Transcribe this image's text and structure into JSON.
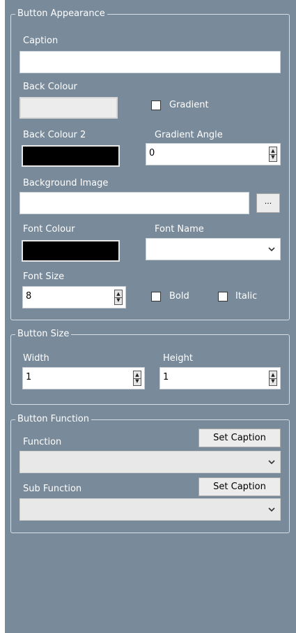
{
  "appearance": {
    "legend": "Button Appearance",
    "caption_label": "Caption",
    "caption_value": "",
    "back_colour_label": "Back Colour",
    "back_colour": "#ececec",
    "gradient_label": "Gradient",
    "gradient_checked": false,
    "back_colour2_label": "Back Colour 2",
    "back_colour2": "#000000",
    "gradient_angle_label": "Gradient Angle",
    "gradient_angle_value": "0",
    "background_image_label": "Background Image",
    "background_image_value": "",
    "browse_label": "...",
    "font_colour_label": "Font Colour",
    "font_colour": "#000000",
    "font_name_label": "Font Name",
    "font_name_value": "",
    "font_size_label": "Font Size",
    "font_size_value": "8",
    "bold_label": "Bold",
    "bold_checked": false,
    "italic_label": "Italic",
    "italic_checked": false
  },
  "size": {
    "legend": "Button Size",
    "width_label": "Width",
    "width_value": "1",
    "height_label": "Height",
    "height_value": "1"
  },
  "function": {
    "legend": "Button Function",
    "function_label": "Function",
    "function_value": "",
    "set_caption_label": "Set Caption",
    "sub_function_label": "Sub Function",
    "sub_function_value": "",
    "set_caption2_label": "Set Caption"
  },
  "colors": {
    "panel_bg": "#798a9a",
    "group_border": "#d6dde3"
  }
}
